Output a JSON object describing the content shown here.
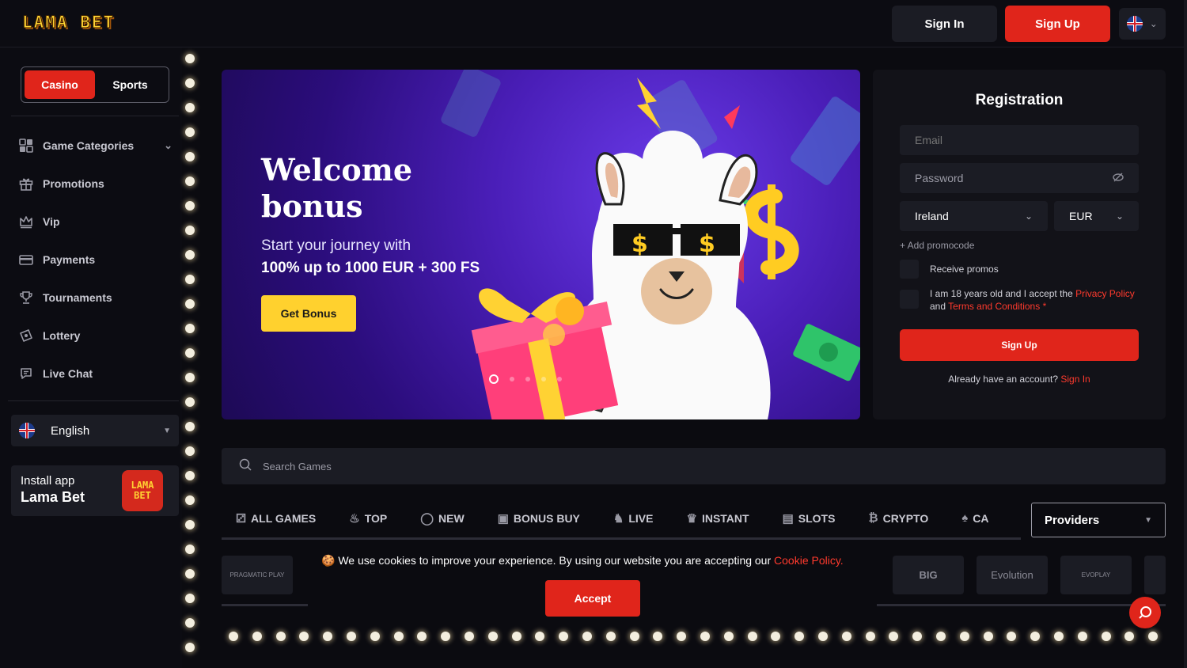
{
  "header": {
    "logo": "LAMA BET",
    "signin_label": "Sign In",
    "signup_label": "Sign Up",
    "lang_icon": "uk-flag-icon"
  },
  "sidebar": {
    "mode": {
      "casino": "Casino",
      "sports": "Sports",
      "active": "Casino"
    },
    "items": [
      {
        "label": "Game Categories",
        "icon": "grid-icon",
        "has_chevron": true
      },
      {
        "label": "Promotions",
        "icon": "gift-icon"
      },
      {
        "label": "Vip",
        "icon": "crown-icon"
      },
      {
        "label": "Payments",
        "icon": "card-icon"
      },
      {
        "label": "Tournaments",
        "icon": "trophy-icon"
      },
      {
        "label": "Lottery",
        "icon": "ticket-icon"
      },
      {
        "label": "Live Chat",
        "icon": "chat-icon"
      }
    ],
    "language": "English",
    "install": {
      "line1": "Install app",
      "line2": "Lama Bet",
      "icon_text_1": "LAMA",
      "icon_text_2": "BET"
    }
  },
  "banner": {
    "title": "Welcome bonus",
    "subtitle1": "Start your journey with",
    "subtitle2": "100% up to 1000 EUR + 300 FS",
    "cta_label": "Get Bonus",
    "slides_total": 5,
    "active_slide": 1
  },
  "registration": {
    "title": "Registration",
    "email_placeholder": "Email",
    "password_placeholder": "Password",
    "country": "Ireland",
    "currency": "EUR",
    "promocode_label": "+ Add promocode",
    "receive_promos": "Receive promos",
    "terms_prefix": "I am 18 years old and I accept the",
    "privacy_policy": "Privacy Policy",
    "terms_and": "and",
    "terms_conditions": "Terms and Conditions",
    "required_mark": "*",
    "submit_label": "Sign Up",
    "already_text": "Already have an account?",
    "signin_link": "Sign In"
  },
  "search": {
    "placeholder": "Search Games"
  },
  "tabs": [
    {
      "label": "ALL GAMES",
      "icon": "dice-icon"
    },
    {
      "label": "TOP",
      "icon": "flame-icon"
    },
    {
      "label": "NEW",
      "icon": "new-badge-icon"
    },
    {
      "label": "BONUS BUY",
      "icon": "gift-box-icon"
    },
    {
      "label": "LIVE",
      "icon": "dealer-icon"
    },
    {
      "label": "INSTANT",
      "icon": "crown-icon"
    },
    {
      "label": "SLOTS",
      "icon": "slot-machine-icon"
    },
    {
      "label": "CRYPTO",
      "icon": "bitcoin-icon"
    },
    {
      "label": "CA",
      "icon": "cards-icon"
    }
  ],
  "providers_label": "Providers",
  "providers": [
    "PRAGMATIC PLAY",
    "BIG",
    "Evolution",
    "EVOPLAY"
  ],
  "cookie": {
    "text": "We use cookies to improve your experience. By using our website you are accepting our",
    "link": "Cookie Policy.",
    "accept_label": "Accept"
  },
  "colors": {
    "accent": "#e0251b",
    "yellow": "#ffd12e",
    "bg": "#0b0b10",
    "panel": "#1b1c24"
  }
}
